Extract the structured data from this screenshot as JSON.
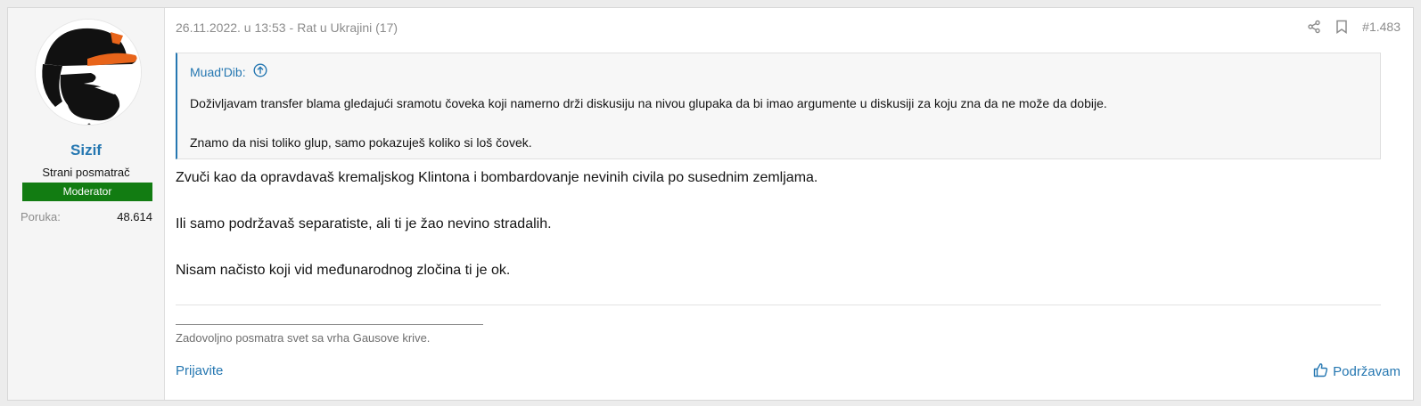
{
  "user": {
    "name": "Sizif",
    "title": "Strani posmatrač",
    "badge": "Moderator",
    "stats": {
      "label": "Poruka:",
      "value": "48.614"
    }
  },
  "post": {
    "date": "26.11.2022. u 13:53",
    "separator": "-",
    "thread": "Rat u Ukrajini (17)",
    "number": "#1.483",
    "quote": {
      "author": "Muad'Dib:",
      "paragraphs": [
        "Doživljavam transfer blama gledajući sramotu čoveka koji namerno drži diskusiju na nivou glupaka da bi imao argumente u diskusiji za koju zna da ne može da dobije.",
        "Znamo da nisi toliko glup, samo pokazuješ koliko si loš čovek."
      ]
    },
    "body": [
      "Zvuči kao da opravdavaš kremaljskog Klintona i bombardovanje nevinih civila po susednim zemljama.",
      "Ili samo podržavaš separatiste, ali ti je žao nevino stradalih.",
      "Nisam načisto koji vid međunarodnog zločina ti je ok."
    ],
    "signature": "Zadovoljno posmatra svet sa vrha Gausove krive.",
    "report_label": "Prijavite",
    "like_label": "Podržavam"
  },
  "icons": {
    "share": "share-icon",
    "bookmark": "bookmark-icon",
    "quote_jump": "arrow-up-circle-icon",
    "like": "thumbs-up-icon"
  },
  "colors": {
    "link": "#2577b1",
    "badge": "#127c12",
    "muted": "#8c8c8c",
    "text": "#141414"
  }
}
